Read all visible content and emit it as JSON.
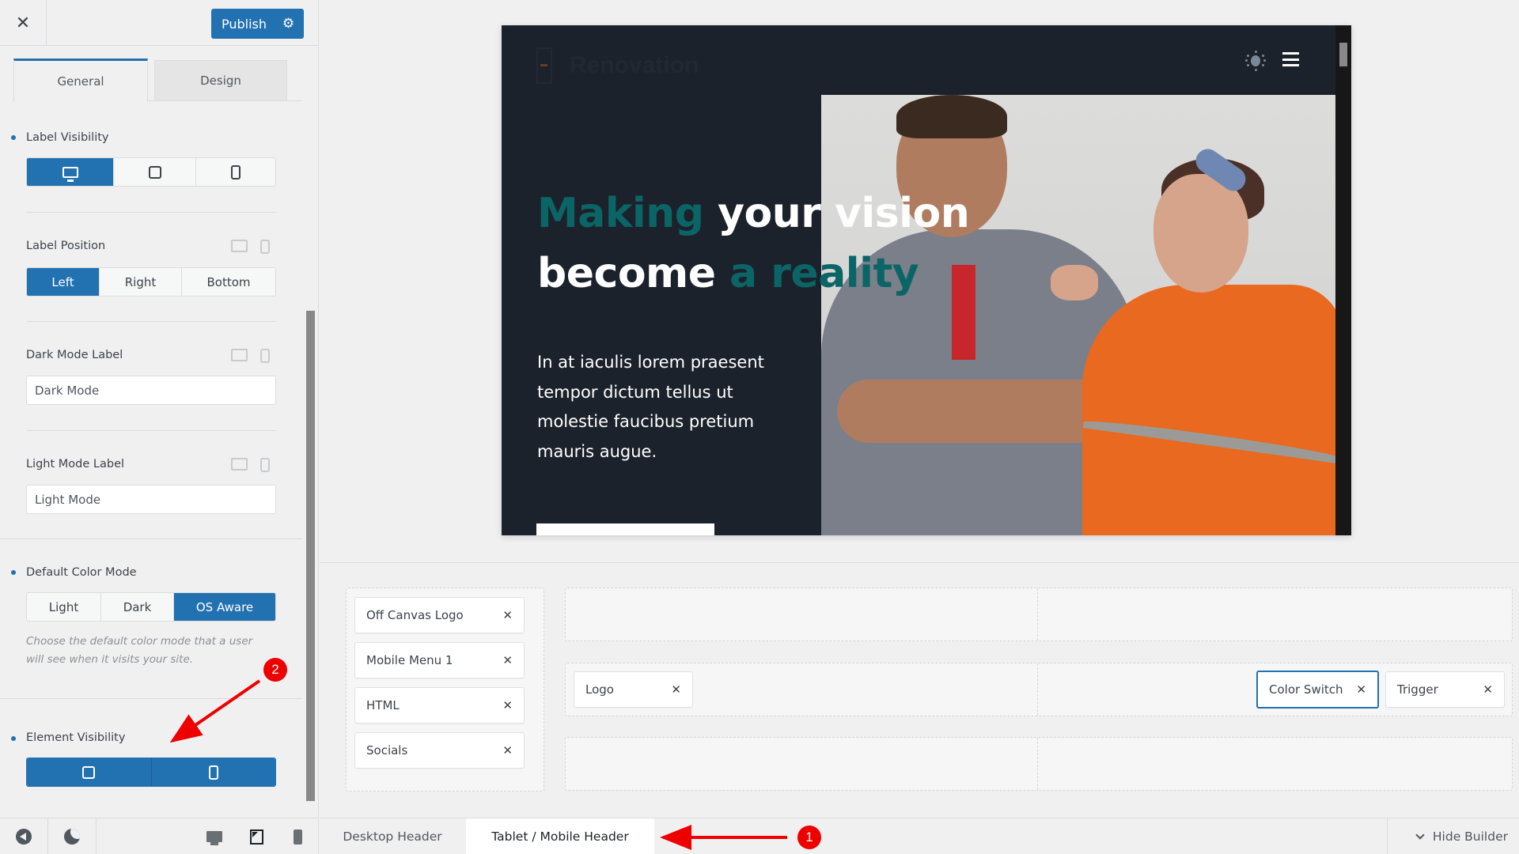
{
  "sidebar": {
    "close_icon": "close-icon",
    "publish_label": "Publish",
    "publish_settings_icon": "gear-icon",
    "tabs": [
      {
        "label": "General",
        "active": true
      },
      {
        "label": "Design",
        "active": false
      }
    ],
    "label_visibility": {
      "title": "Label Visibility",
      "options": [
        {
          "icon": "desktop-icon",
          "active": true
        },
        {
          "icon": "tablet-icon",
          "active": false
        },
        {
          "icon": "mobile-icon",
          "active": false
        }
      ]
    },
    "label_position": {
      "title": "Label Position",
      "options": [
        "Left",
        "Right",
        "Bottom"
      ],
      "selected": "Left"
    },
    "dark_mode_label": {
      "title": "Dark Mode Label",
      "value": "Dark Mode"
    },
    "light_mode_label": {
      "title": "Light Mode Label",
      "value": "Light Mode"
    },
    "default_color_mode": {
      "title": "Default Color Mode",
      "options": [
        "Light",
        "Dark",
        "OS Aware"
      ],
      "selected": "OS Aware",
      "description": "Choose the default color mode that a user will see when it visits your site."
    },
    "element_visibility": {
      "title": "Element Visibility",
      "options": [
        {
          "icon": "tablet-icon",
          "active": true
        },
        {
          "icon": "mobile-icon",
          "active": true
        }
      ]
    },
    "footer": {
      "back_icon": "back-circle-icon",
      "dark_mode_icon": "moon-icon",
      "devices": [
        "desktop-icon",
        "tablet-icon",
        "mobile-icon"
      ],
      "active_device": "tablet"
    }
  },
  "preview": {
    "logo_text": "Renovation",
    "heading": {
      "line1_accent": "Making",
      "line1_rest": " your vision",
      "line2_start": "become ",
      "line2_accent": "a reality"
    },
    "body": "In at iaculis lorem praesent tempor dictum tellus ut molestie faucibus pretium mauris augue.",
    "colors": {
      "background": "#1c222c",
      "accent": "#0b6566",
      "logo_accent": "#f26722"
    }
  },
  "builder": {
    "offcanvas_items": [
      "Off Canvas Logo",
      "Mobile Menu 1",
      "HTML",
      "Socials"
    ],
    "main_row": {
      "left": [
        "Logo"
      ],
      "right": [
        {
          "label": "Color Switch",
          "selected": true
        },
        {
          "label": "Trigger",
          "selected": false
        }
      ]
    },
    "remove_icon": "close-icon"
  },
  "bottom_tabs": {
    "tabs": [
      {
        "label": "Desktop Header",
        "active": false
      },
      {
        "label": "Tablet / Mobile Header",
        "active": true
      }
    ],
    "hide_builder": "Hide Builder"
  },
  "annotations": [
    {
      "number": "1",
      "target": "Tablet / Mobile Header tab"
    },
    {
      "number": "2",
      "target": "Element Visibility"
    }
  ],
  "colors": {
    "primary": "#2271b1",
    "annotation": "#ee0000"
  }
}
